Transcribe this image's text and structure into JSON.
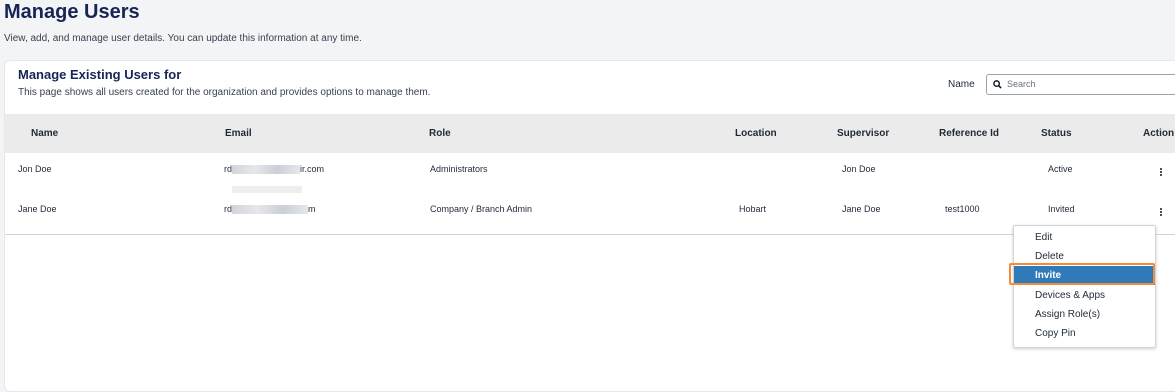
{
  "header": {
    "title": "Manage Users",
    "description": "View, add, and manage user details. You can update this information at any time."
  },
  "card": {
    "title": "Manage Existing Users for",
    "description": "This page shows all users created for the organization and provides options to manage them.",
    "search": {
      "label": "Name",
      "placeholder": "Search",
      "value": ""
    }
  },
  "table": {
    "columns": [
      "Name",
      "Email",
      "Role",
      "Location",
      "Supervisor",
      "Reference Id",
      "Status",
      "Action"
    ],
    "rows": [
      {
        "name": "Jon Doe",
        "email_prefix": "rd",
        "email_suffix": "ir.com",
        "role": "Administrators",
        "location": "",
        "supervisor": "Jon Doe",
        "reference_id": "",
        "status": "Active"
      },
      {
        "name": "Jane Doe",
        "email_prefix": "rd",
        "email_suffix": "m",
        "role": "Company / Branch Admin",
        "location": "Hobart",
        "supervisor": "Jane Doe",
        "reference_id": "test1000",
        "status": "Invited"
      }
    ]
  },
  "action_menu": {
    "items": [
      "Edit",
      "Delete",
      "Invite",
      "Devices & Apps",
      "Assign Role(s)",
      "Copy Pin"
    ],
    "selected": "Invite"
  },
  "icons": {
    "search": "search-icon",
    "more": "more-vertical-icon"
  },
  "colors": {
    "title": "#172554",
    "menu_selected": "#2f7ab8",
    "highlight": "#f28c38"
  }
}
